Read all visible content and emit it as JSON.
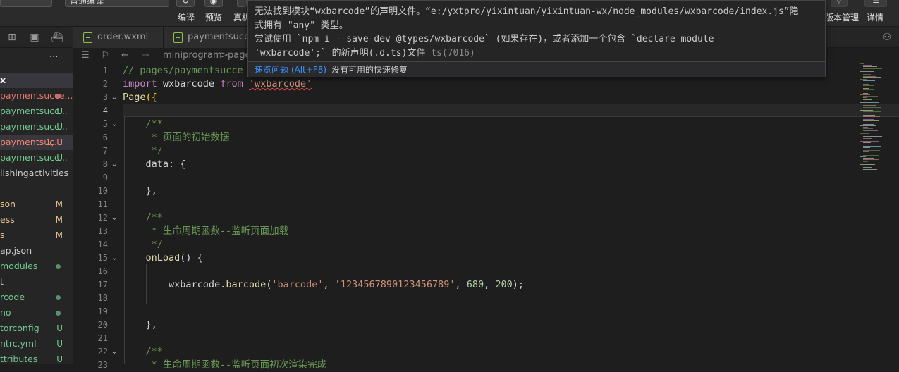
{
  "toolbar": {
    "mode_select": "普通编译",
    "menu": [
      "编译",
      "预览",
      "真机"
    ],
    "right_menu": [
      "版本管理",
      "详情"
    ]
  },
  "tabs": [
    "order.wxml",
    "paymentsucce"
  ],
  "breadcrumb": {
    "root": "miniprogram",
    "sep": ">",
    "next": "page"
  },
  "sidebar": {
    "more": "···",
    "rows": [
      {
        "label": "x",
        "status": "",
        "color": "#ffffff",
        "selected": true,
        "bold": true
      },
      {
        "label": "paymentsucce...",
        "status": "dot",
        "color": "#e2766c",
        "statusColor": "#c76c6c"
      },
      {
        "label": "paymentsucc...",
        "status": "U",
        "color": "#73c991",
        "statusColor": "#73c991"
      },
      {
        "label": "paymentsucc...",
        "status": "U",
        "color": "#73c991",
        "statusColor": "#73c991"
      },
      {
        "label": "paymentsuc...",
        "status": "1, U",
        "color": "#f48771",
        "statusColor": "#f48771",
        "selected": true
      },
      {
        "label": "paymentsucc...",
        "status": "U",
        "color": "#73c991",
        "statusColor": "#73c991"
      },
      {
        "label": "lishingactivities",
        "status": "",
        "color": "#cccccc"
      },
      {
        "label": "",
        "status": "",
        "color": "#cccccc"
      },
      {
        "label": "son",
        "status": "M",
        "color": "#e2c08d",
        "statusColor": "#e2c08d"
      },
      {
        "label": "ess",
        "status": "M",
        "color": "#e2c08d",
        "statusColor": "#e2c08d"
      },
      {
        "label": "s",
        "status": "M",
        "color": "#e2c08d",
        "statusColor": "#e2c08d"
      },
      {
        "label": "ap.json",
        "status": "",
        "color": "#cccccc"
      },
      {
        "label": "modules",
        "status": "dot",
        "color": "#73c991",
        "statusColor": "#5c8f6a"
      },
      {
        "label": "t",
        "status": "",
        "color": "#cccccc"
      },
      {
        "label": "rcode",
        "status": "dot",
        "color": "#73c991",
        "statusColor": "#5c8f6a"
      },
      {
        "label": "no",
        "status": "dot",
        "color": "#73c991",
        "statusColor": "#5c8f6a"
      },
      {
        "label": "torconfig",
        "status": "U",
        "color": "#73c991",
        "statusColor": "#73c991"
      },
      {
        "label": "ntrc.yml",
        "status": "U",
        "color": "#73c991",
        "statusColor": "#73c991"
      },
      {
        "label": "ttributes",
        "status": "U",
        "color": "#73c991",
        "statusColor": "#73c991"
      }
    ]
  },
  "tooltip": {
    "message_line1": "无法找到模块“wxbarcode”的声明文件。“e:/yxtpro/yixintuan/yixintuan-wx/node_modules/wxbarcode/index.js”隐",
    "message_line2": "式拥有 \"any\" 类型。",
    "message_line3": "  尝试使用 `npm i --save-dev @types/wxbarcode` (如果存在)，或者添加一个包含 `declare module",
    "message_line4": "'wxbarcode';` 的新声明(.d.ts)文件",
    "code": "ts(7016)",
    "action_peek": "速览问题 (Alt+F8)",
    "action_fix": "没有可用的快速修复"
  },
  "code_lines": [
    {
      "n": "1",
      "fold": "",
      "tokens": [
        {
          "t": "// pages/paymentsucce",
          "c": "c-cm"
        }
      ]
    },
    {
      "n": "2",
      "fold": "",
      "tokens": [
        {
          "t": "import",
          "c": "c-kw"
        },
        {
          "t": " wxbarcode ",
          "c": "c-id"
        },
        {
          "t": "from",
          "c": "c-kw"
        },
        {
          "t": " ",
          "c": "c-id"
        },
        {
          "t": "'wxbarcode'",
          "c": "c-str squig"
        }
      ]
    },
    {
      "n": "3",
      "fold": "v",
      "tokens": [
        {
          "t": "Page",
          "c": "c-fn"
        },
        {
          "t": "({",
          "c": "c-br"
        }
      ]
    },
    {
      "n": "4",
      "fold": "",
      "tokens": []
    },
    {
      "n": "5",
      "fold": "v",
      "tokens": [
        {
          "t": "    /**",
          "c": "c-cm"
        }
      ]
    },
    {
      "n": "6",
      "fold": "",
      "tokens": [
        {
          "t": "     * 页面的初始数据",
          "c": "c-cm"
        }
      ]
    },
    {
      "n": "7",
      "fold": "",
      "tokens": [
        {
          "t": "     */",
          "c": "c-cm"
        }
      ]
    },
    {
      "n": "8",
      "fold": "v",
      "tokens": [
        {
          "t": "    data",
          "c": "c-id"
        },
        {
          "t": ": {",
          "c": "c-id"
        }
      ]
    },
    {
      "n": "9",
      "fold": "",
      "tokens": []
    },
    {
      "n": "10",
      "fold": "",
      "tokens": [
        {
          "t": "    },",
          "c": "c-id"
        }
      ]
    },
    {
      "n": "11",
      "fold": "",
      "tokens": []
    },
    {
      "n": "12",
      "fold": "v",
      "tokens": [
        {
          "t": "    /**",
          "c": "c-cm"
        }
      ]
    },
    {
      "n": "13",
      "fold": "",
      "tokens": [
        {
          "t": "     * 生命周期函数--监听页面加载",
          "c": "c-cm"
        }
      ]
    },
    {
      "n": "14",
      "fold": "",
      "tokens": [
        {
          "t": "     */",
          "c": "c-cm"
        }
      ]
    },
    {
      "n": "15",
      "fold": "v",
      "tokens": [
        {
          "t": "    onLoad",
          "c": "c-fn"
        },
        {
          "t": "() {",
          "c": "c-id"
        }
      ]
    },
    {
      "n": "16",
      "fold": "",
      "tokens": []
    },
    {
      "n": "17",
      "fold": "",
      "tokens": [
        {
          "t": "        wxbarcode",
          "c": "c-id"
        },
        {
          "t": ".",
          "c": "c-id"
        },
        {
          "t": "barcode",
          "c": "c-fn"
        },
        {
          "t": "(",
          "c": "c-id"
        },
        {
          "t": "'barcode'",
          "c": "c-str"
        },
        {
          "t": ", ",
          "c": "c-id"
        },
        {
          "t": "'1234567890123456789'",
          "c": "c-str"
        },
        {
          "t": ", ",
          "c": "c-id"
        },
        {
          "t": "680",
          "c": "c-num"
        },
        {
          "t": ", ",
          "c": "c-id"
        },
        {
          "t": "200",
          "c": "c-num"
        },
        {
          "t": ");",
          "c": "c-id"
        }
      ]
    },
    {
      "n": "18",
      "fold": "",
      "tokens": []
    },
    {
      "n": "19",
      "fold": "",
      "tokens": []
    },
    {
      "n": "20",
      "fold": "",
      "tokens": [
        {
          "t": "    },",
          "c": "c-id"
        }
      ]
    },
    {
      "n": "21",
      "fold": "",
      "tokens": []
    },
    {
      "n": "22",
      "fold": "v",
      "tokens": [
        {
          "t": "    /**",
          "c": "c-cm"
        }
      ]
    },
    {
      "n": "23",
      "fold": "",
      "tokens": [
        {
          "t": "     * 生命周期函数--监听页面初次渲染完成",
          "c": "c-cm"
        }
      ]
    }
  ],
  "current_line": 4
}
